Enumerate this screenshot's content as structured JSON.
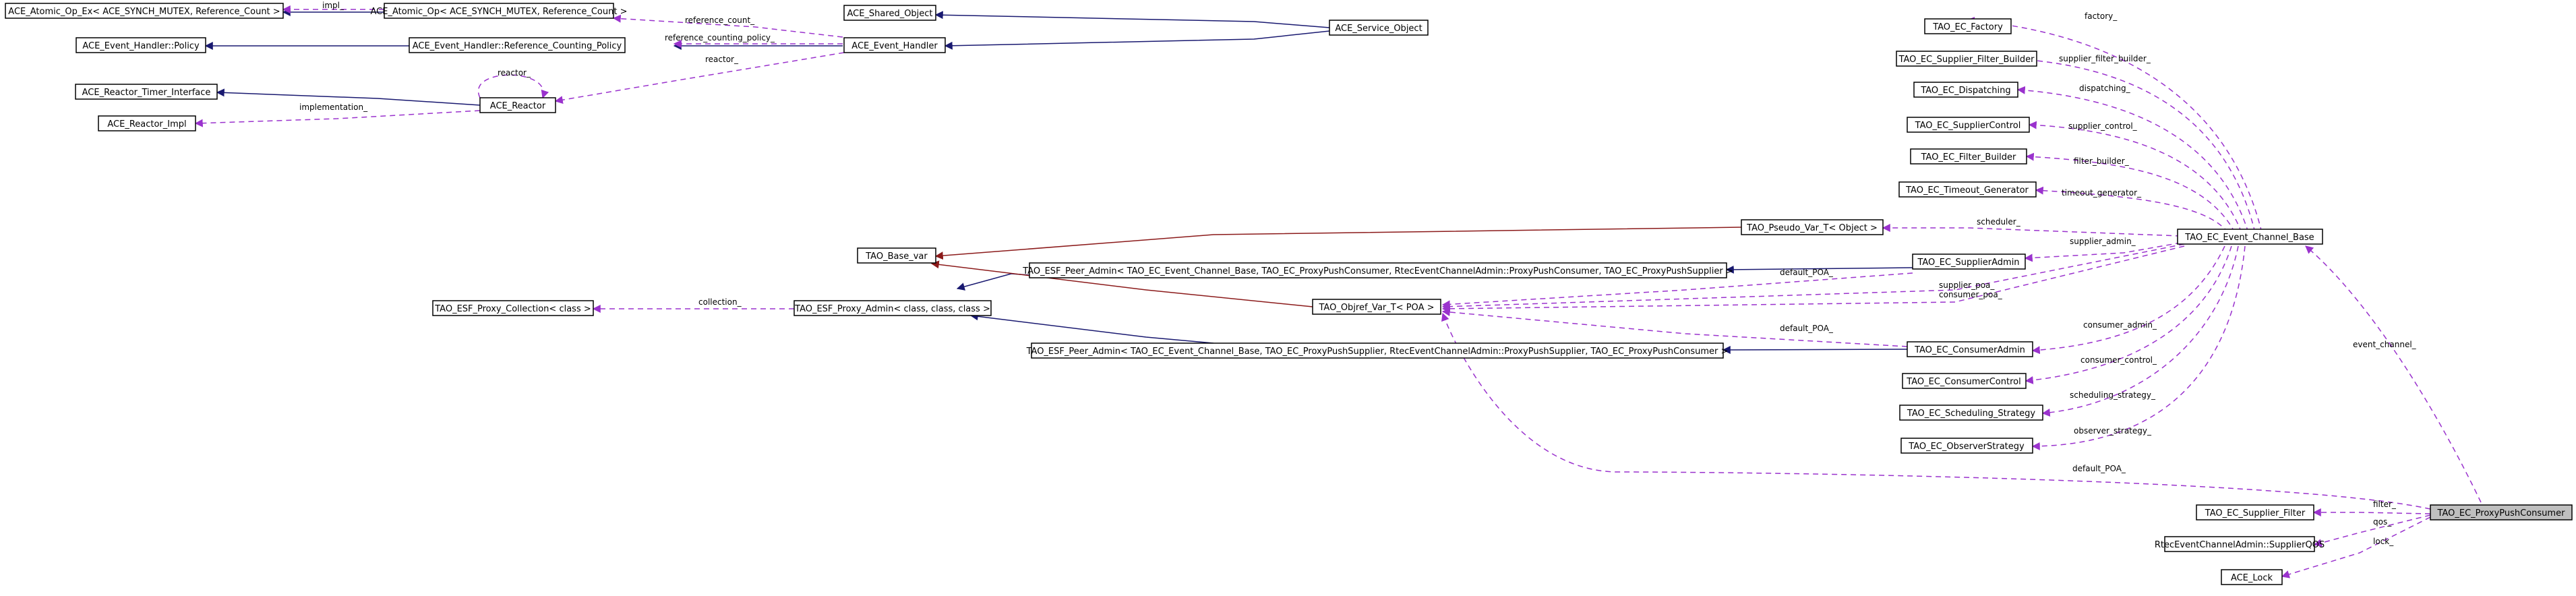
{
  "diagram": {
    "nodes": [
      {
        "id": "ace_atomic_ex",
        "label": "ACE_Atomic_Op_Ex< ACE_SYNCH_MUTEX, Reference_Count >"
      },
      {
        "id": "ace_atomic",
        "label": "ACE_Atomic_Op< ACE_SYNCH_MUTEX, Reference_Count >"
      },
      {
        "id": "ace_shared",
        "label": "ACE_Shared_Object"
      },
      {
        "id": "ace_service",
        "label": "ACE_Service_Object"
      },
      {
        "id": "ehp",
        "label": "ACE_Event_Handler::Policy"
      },
      {
        "id": "ehrcp",
        "label": "ACE_Event_Handler::Reference_Counting_Policy"
      },
      {
        "id": "aeh",
        "label": "ACE_Event_Handler"
      },
      {
        "id": "art",
        "label": "ACE_Reactor_Timer_Interface"
      },
      {
        "id": "ar",
        "label": "ACE_Reactor"
      },
      {
        "id": "ari",
        "label": "ACE_Reactor_Impl"
      },
      {
        "id": "tbv",
        "label": "TAO_Base_var"
      },
      {
        "id": "tpc",
        "label": "TAO_ESF_Proxy_Collection< class >"
      },
      {
        "id": "tpa",
        "label": "TAO_ESF_Proxy_Admin< class, class, class >"
      },
      {
        "id": "tpa1",
        "label": "TAO_ESF_Peer_Admin< TAO_EC_Event_Channel_Base, TAO_EC_ProxyPushConsumer, RtecEventChannelAdmin::ProxyPushConsumer, TAO_EC_ProxyPushSupplier >"
      },
      {
        "id": "tpa2",
        "label": "TAO_ESF_Peer_Admin< TAO_EC_Event_Channel_Base, TAO_EC_ProxyPushSupplier, RtecEventChannelAdmin::ProxyPushSupplier, TAO_EC_ProxyPushConsumer >"
      },
      {
        "id": "tov",
        "label": "TAO_Objref_Var_T< POA >"
      },
      {
        "id": "tpv",
        "label": "TAO_Pseudo_Var_T< Object >"
      },
      {
        "id": "tef",
        "label": "TAO_EC_Factory"
      },
      {
        "id": "tsfb",
        "label": "TAO_EC_Supplier_Filter_Builder"
      },
      {
        "id": "tdisp",
        "label": "TAO_EC_Dispatching"
      },
      {
        "id": "tsc",
        "label": "TAO_EC_SupplierControl"
      },
      {
        "id": "tfb",
        "label": "TAO_EC_Filter_Builder"
      },
      {
        "id": "ttg",
        "label": "TAO_EC_Timeout_Generator"
      },
      {
        "id": "tsa",
        "label": "TAO_EC_SupplierAdmin"
      },
      {
        "id": "tca",
        "label": "TAO_EC_ConsumerAdmin"
      },
      {
        "id": "tcc",
        "label": "TAO_EC_ConsumerControl"
      },
      {
        "id": "tss",
        "label": "TAO_EC_Scheduling_Strategy"
      },
      {
        "id": "tos",
        "label": "TAO_EC_ObserverStrategy"
      },
      {
        "id": "tecb",
        "label": "TAO_EC_Event_Channel_Base"
      },
      {
        "id": "tsf",
        "label": "TAO_EC_Supplier_Filter"
      },
      {
        "id": "rsq",
        "label": "RtecEventChannelAdmin::SupplierQOS"
      },
      {
        "id": "tlock",
        "label": "ACE_Lock"
      },
      {
        "id": "tppc",
        "label": "TAO_EC_ProxyPushConsumer"
      }
    ],
    "edge_labels": {
      "impl": "impl_",
      "reference_count": "reference_count_",
      "reference_counting_policy": "reference_counting_policy_",
      "reactor_self": "reactor_",
      "reactor": "reactor_",
      "implementation": "implementation_",
      "collection": "collection_",
      "factory": "factory_",
      "supplier_filter_builder": "supplier_filter_builder_",
      "dispatching": "dispatching_",
      "supplier_control": "supplier_control_",
      "filter_builder": "filter_builder_",
      "timeout_generator": "timeout_generator_",
      "scheduler": "scheduler_",
      "supplier_admin": "supplier_admin_",
      "default_poa_a": "default_POA_",
      "supplier_poa": "supplier_poa_",
      "consumer_poa": "consumer_poa_",
      "default_poa_b": "default_POA_",
      "consumer_admin": "consumer_admin_",
      "consumer_control": "consumer_control_",
      "scheduling_strategy": "scheduling_strategy_",
      "observer_strategy": "observer_strategy_",
      "event_channel": "event_channel_",
      "default_poa_c": "default_POA_",
      "filter": "filter_",
      "qos": "qos_",
      "lock": "lock_"
    },
    "legend_colors": {
      "inheritance": "#191970",
      "template_instance": "#8b1a1a",
      "usage": "#9a32cd"
    }
  }
}
